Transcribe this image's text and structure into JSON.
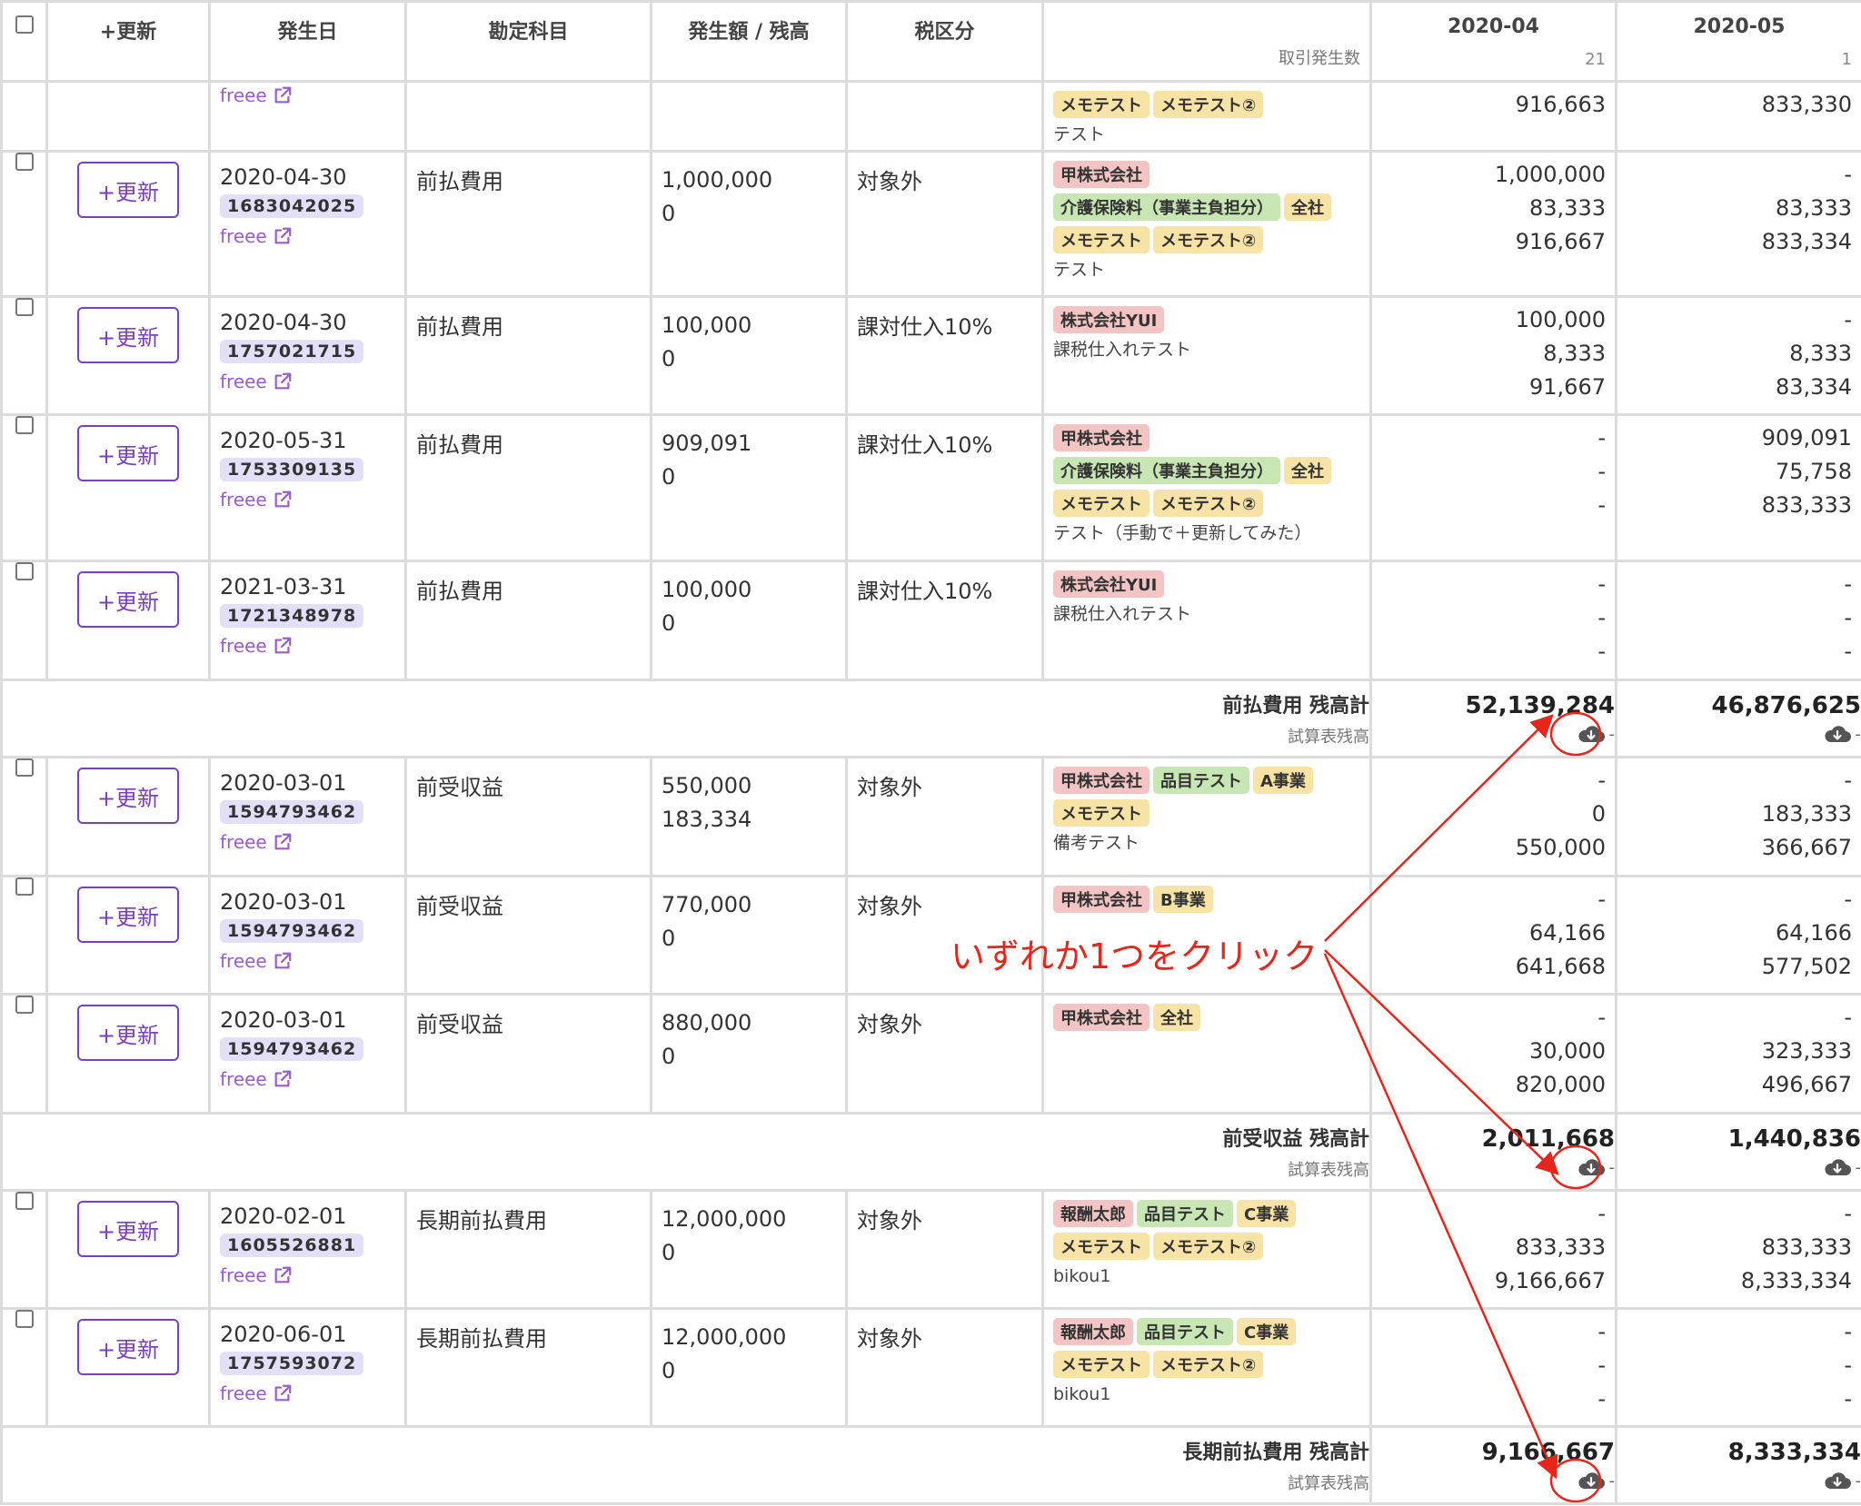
{
  "header": {
    "update": "+更新",
    "date": "発生日",
    "account": "勘定科目",
    "amount": "発生額 / 残高",
    "tax": "税区分",
    "memo_sub": "取引発生数",
    "months": [
      {
        "label": "2020-04",
        "count": "21"
      },
      {
        "label": "2020-05",
        "count": "1"
      }
    ]
  },
  "update_label": "+更新",
  "freee_label": "freee",
  "partial_row": {
    "tags": [
      [
        {
          "t": "メモテスト",
          "c": "yellow"
        },
        {
          "t": "メモテスト②",
          "c": "yellow"
        }
      ]
    ],
    "note": "テスト",
    "m1": [
      "916,663"
    ],
    "m2": [
      "833,330"
    ]
  },
  "rows_a": [
    {
      "date": "2020-04-30",
      "id": "1683042025",
      "account": "前払費用",
      "amount": "1,000,000",
      "balance": "0",
      "tax": "対象外",
      "tags": [
        [
          {
            "t": "甲株式会社",
            "c": "red"
          }
        ],
        [
          {
            "t": "介護保険料（事業主負担分）",
            "c": "green"
          },
          {
            "t": "全社",
            "c": "yellow"
          }
        ],
        [
          {
            "t": "メモテスト",
            "c": "yellow"
          },
          {
            "t": "メモテスト②",
            "c": "yellow"
          }
        ]
      ],
      "note": "テスト",
      "m1": [
        "1,000,000",
        "83,333",
        "916,667"
      ],
      "m2": [
        "-",
        "83,333",
        "833,334"
      ]
    },
    {
      "date": "2020-04-30",
      "id": "1757021715",
      "account": "前払費用",
      "amount": "100,000",
      "balance": "0",
      "tax": "課対仕入10%",
      "tags": [
        [
          {
            "t": "株式会社YUI",
            "c": "red"
          }
        ]
      ],
      "note": "課税仕入れテスト",
      "m1": [
        "100,000",
        "8,333",
        "91,667"
      ],
      "m2": [
        "-",
        "8,333",
        "83,334"
      ]
    },
    {
      "date": "2020-05-31",
      "id": "1753309135",
      "account": "前払費用",
      "amount": "909,091",
      "balance": "0",
      "tax": "課対仕入10%",
      "tags": [
        [
          {
            "t": "甲株式会社",
            "c": "red"
          }
        ],
        [
          {
            "t": "介護保険料（事業主負担分）",
            "c": "green"
          },
          {
            "t": "全社",
            "c": "yellow"
          }
        ],
        [
          {
            "t": "メモテスト",
            "c": "yellow"
          },
          {
            "t": "メモテスト②",
            "c": "yellow"
          }
        ]
      ],
      "note": "テスト（手動で＋更新してみた）",
      "m1": [
        "-",
        "-",
        "-"
      ],
      "m2": [
        "909,091",
        "75,758",
        "833,333"
      ]
    },
    {
      "date": "2021-03-31",
      "id": "1721348978",
      "account": "前払費用",
      "amount": "100,000",
      "balance": "0",
      "tax": "課対仕入10%",
      "tags": [
        [
          {
            "t": "株式会社YUI",
            "c": "red"
          }
        ]
      ],
      "note": "課税仕入れテスト",
      "m1": [
        "-",
        "-",
        "-"
      ],
      "m2": [
        "-",
        "-",
        "-"
      ]
    }
  ],
  "total_a": {
    "label": "前払費用 残高計",
    "sub": "試算表残高",
    "v1": "52,139,284",
    "v2": "46,876,625"
  },
  "rows_b": [
    {
      "date": "2020-03-01",
      "id": "1594793462",
      "account": "前受収益",
      "amount": "550,000",
      "balance": "183,334",
      "tax": "対象外",
      "tags": [
        [
          {
            "t": "甲株式会社",
            "c": "red"
          },
          {
            "t": "品目テスト",
            "c": "green"
          },
          {
            "t": "A事業",
            "c": "yellow"
          }
        ],
        [
          {
            "t": "メモテスト",
            "c": "yellow"
          }
        ]
      ],
      "note": "備考テスト",
      "m1": [
        "-",
        "0",
        "550,000"
      ],
      "m2": [
        "-",
        "183,333",
        "366,667"
      ]
    },
    {
      "date": "2020-03-01",
      "id": "1594793462",
      "account": "前受収益",
      "amount": "770,000",
      "balance": "0",
      "tax": "対象外",
      "tags": [
        [
          {
            "t": "甲株式会社",
            "c": "red"
          },
          {
            "t": "B事業",
            "c": "yellow"
          }
        ]
      ],
      "note": "",
      "m1": [
        "-",
        "64,166",
        "641,668"
      ],
      "m2": [
        "-",
        "64,166",
        "577,502"
      ]
    },
    {
      "date": "2020-03-01",
      "id": "1594793462",
      "account": "前受収益",
      "amount": "880,000",
      "balance": "0",
      "tax": "対象外",
      "tags": [
        [
          {
            "t": "甲株式会社",
            "c": "red"
          },
          {
            "t": "全社",
            "c": "yellow"
          }
        ]
      ],
      "note": "",
      "m1": [
        "-",
        "30,000",
        "820,000"
      ],
      "m2": [
        "-",
        "323,333",
        "496,667"
      ]
    }
  ],
  "total_b": {
    "label": "前受収益 残高計",
    "sub": "試算表残高",
    "v1": "2,011,668",
    "v2": "1,440,836"
  },
  "rows_c": [
    {
      "date": "2020-02-01",
      "id": "1605526881",
      "account": "長期前払費用",
      "amount": "12,000,000",
      "balance": "0",
      "tax": "対象外",
      "tags": [
        [
          {
            "t": "報酬太郎",
            "c": "red"
          },
          {
            "t": "品目テスト",
            "c": "green"
          },
          {
            "t": "C事業",
            "c": "yellow"
          }
        ],
        [
          {
            "t": "メモテスト",
            "c": "yellow"
          },
          {
            "t": "メモテスト②",
            "c": "yellow"
          }
        ]
      ],
      "note": "bikou1",
      "m1": [
        "-",
        "833,333",
        "9,166,667"
      ],
      "m2": [
        "-",
        "833,333",
        "8,333,334"
      ]
    },
    {
      "date": "2020-06-01",
      "id": "1757593072",
      "account": "長期前払費用",
      "amount": "12,000,000",
      "balance": "0",
      "tax": "対象外",
      "tags": [
        [
          {
            "t": "報酬太郎",
            "c": "red"
          },
          {
            "t": "品目テスト",
            "c": "green"
          },
          {
            "t": "C事業",
            "c": "yellow"
          }
        ],
        [
          {
            "t": "メモテスト",
            "c": "yellow"
          },
          {
            "t": "メモテスト②",
            "c": "yellow"
          }
        ]
      ],
      "note": "bikou1",
      "m1": [
        "-",
        "-",
        "-"
      ],
      "m2": [
        "-",
        "-",
        "-"
      ]
    }
  ],
  "total_c": {
    "label": "長期前払費用 残高計",
    "sub": "試算表残高",
    "v1": "9,166,667",
    "v2": "8,333,334"
  },
  "dash": "-",
  "annotation": {
    "text": "いずれか1つをクリック",
    "color": "#e8251b"
  },
  "colors": {
    "accent": "#7b3fc4",
    "id_badge": "#e3dff8",
    "tag_red": "#f3c4c4",
    "tag_green": "#c8e6b4",
    "tag_yellow": "#f7e3a6"
  }
}
